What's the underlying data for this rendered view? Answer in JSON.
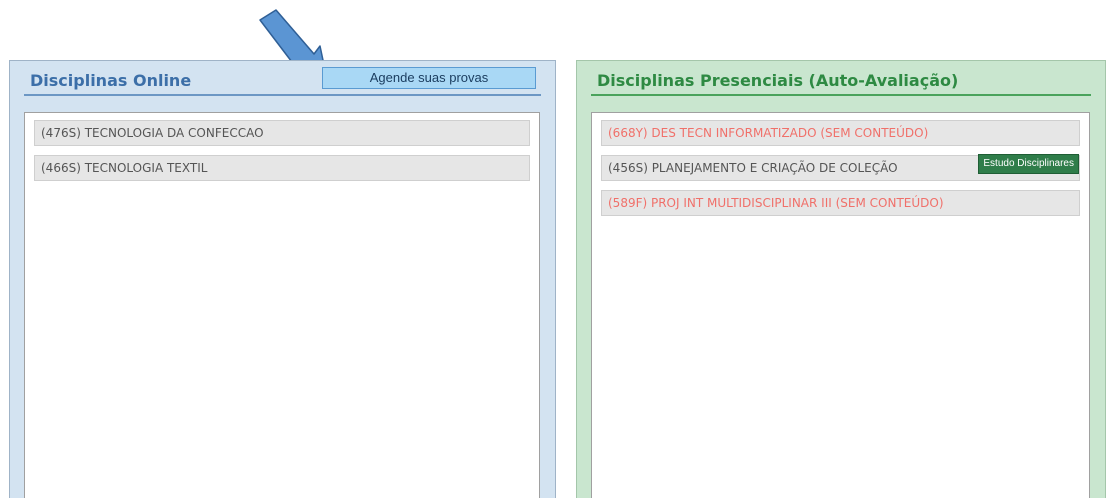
{
  "colors": {
    "online_panel_bg": "#d3e3f1",
    "online_title": "#3c6fa8",
    "presencial_panel_bg": "#c9e6cf",
    "presencial_title": "#2e8a43",
    "no_content_text": "#f0706a",
    "badge_bg": "#2f7d4a",
    "arrow": "#5b95d3"
  },
  "online": {
    "title": "Disciplinas Online",
    "schedule_button": "Agende suas provas",
    "courses": [
      {
        "label": "(476S) TECNOLOGIA DA CONFECCAO"
      },
      {
        "label": "(466S) TECNOLOGIA TEXTIL"
      }
    ]
  },
  "presencial": {
    "title": "Disciplinas Presenciais (Auto-Avaliação)",
    "courses": [
      {
        "label": "(668Y) DES TECN INFORMATIZADO (SEM CONTEÚDO)",
        "status": "no-content"
      },
      {
        "label": "(456S) PLANEJAMENTO E CRIAÇÃO DE COLEÇÃO",
        "status": "normal",
        "badge": "Estudo Disciplinares"
      },
      {
        "label": "(589F) PROJ INT MULTIDISCIPLINAR III (SEM CONTEÚDO)",
        "status": "no-content"
      }
    ]
  },
  "annotation": {
    "icon": "arrow-down-right-icon"
  }
}
